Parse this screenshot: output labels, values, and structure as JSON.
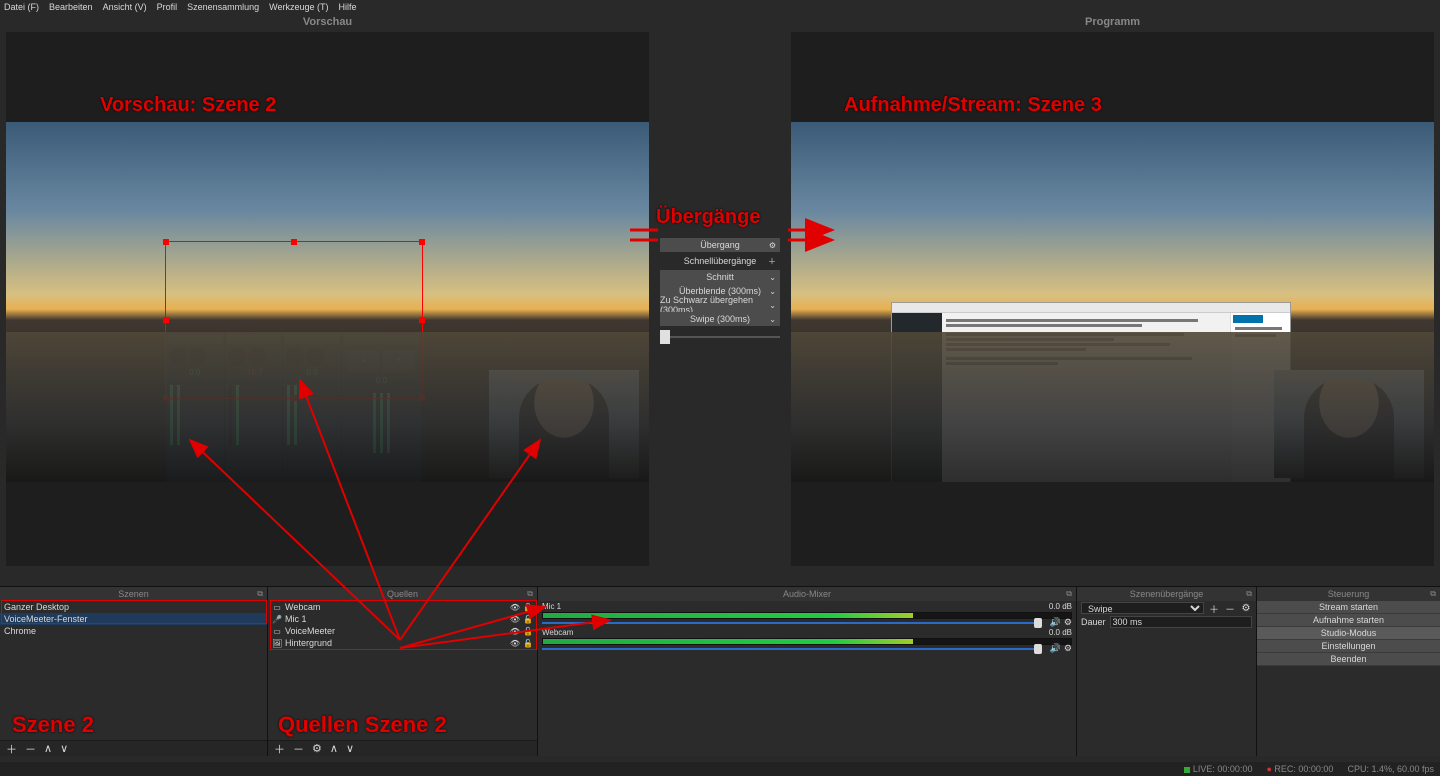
{
  "menubar": [
    "Datei (F)",
    "Bearbeiten",
    "Ansicht (V)",
    "Profil",
    "Szenensammlung",
    "Werkzeuge (T)",
    "Hilfe"
  ],
  "studio": {
    "preview_title": "Vorschau",
    "program_title": "Programm"
  },
  "annotations": {
    "preview": "Vorschau: Szene 2",
    "program": "Aufnahme/Stream: Szene 3",
    "transitions": "Übergänge",
    "scene_lbl": "Szene 2",
    "sources_lbl": "Quellen Szene 2"
  },
  "transitions": {
    "main_btn": "Übergang",
    "quick_label": "Schnellübergänge",
    "items": [
      "Schnitt",
      "Überblende (300ms)",
      "Zu Schwarz übergehen (300ms)",
      "Swipe (300ms)"
    ]
  },
  "docks": {
    "scenes": {
      "title": "Szenen",
      "items": [
        "Ganzer Desktop",
        "VoiceMeeter-Fenster",
        "Chrome"
      ],
      "selected": 1
    },
    "sources": {
      "title": "Quellen",
      "items": [
        {
          "icon": "▭",
          "name": "Webcam"
        },
        {
          "icon": "🎤",
          "name": "Mic 1"
        },
        {
          "icon": "▭",
          "name": "VoiceMeeter"
        },
        {
          "icon": "🖼",
          "name": "Hintergrund"
        }
      ]
    },
    "mixer": {
      "title": "Audio-Mixer",
      "channels": [
        {
          "name": "Mic 1",
          "db": "0.0 dB"
        },
        {
          "name": "Webcam",
          "db": "0.0 dB"
        }
      ]
    },
    "scene_trans": {
      "title": "Szenenübergänge",
      "selected": "Swipe",
      "duration_label": "Dauer",
      "duration": "300 ms"
    },
    "controls": {
      "title": "Steuerung",
      "buttons": [
        "Stream starten",
        "Aufnahme starten",
        "Studio-Modus",
        "Einstellungen",
        "Beenden"
      ],
      "active": 2
    }
  },
  "status": {
    "live": "LIVE: 00:00:00",
    "rec": "REC: 00:00:00",
    "cpu": "CPU: 1.4%, 60.00 fps"
  },
  "voicemeeter": {
    "vals": [
      "0.0",
      "0.0",
      "-15.7",
      "0.0",
      "0.0"
    ]
  }
}
